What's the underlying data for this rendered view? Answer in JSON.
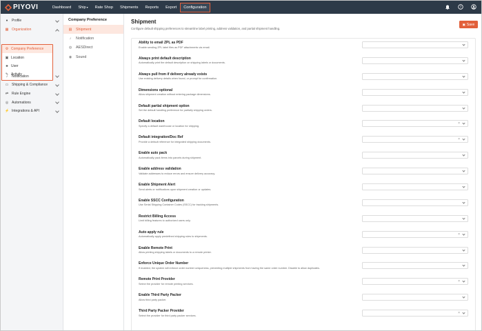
{
  "app": {
    "logo_text": "PIYOVI",
    "nav": [
      {
        "label": "Dashboard"
      },
      {
        "label": "Ship",
        "caret": "▾"
      },
      {
        "label": "Rate Shop"
      },
      {
        "label": "Shipments"
      },
      {
        "label": "Reports"
      },
      {
        "label": "Export"
      },
      {
        "label": "Configuration"
      }
    ],
    "top_icons": [
      "bell-icon",
      "help-icon",
      "user-icon"
    ],
    "accent_color": "#e2603b",
    "topbar_color": "#2d3a48"
  },
  "sidebar": {
    "items": [
      {
        "label": "Profile",
        "icon": "user-icon"
      },
      {
        "label": "Organization",
        "icon": "building-icon"
      }
    ],
    "org_sub": [
      {
        "label": "Company Preference",
        "icon": "gear-icon"
      },
      {
        "label": "Location",
        "icon": "location-icon"
      },
      {
        "label": "User",
        "icon": "users-icon"
      },
      {
        "label": "Activity",
        "icon": "activity-icon"
      }
    ],
    "items_after": [
      {
        "label": "Notification",
        "icon": "bell-icon"
      },
      {
        "label": "Shipping & Compliance",
        "icon": "truck-icon"
      },
      {
        "label": "Rule Engine",
        "icon": "rule-icon"
      },
      {
        "label": "Automations",
        "icon": "automation-icon"
      },
      {
        "label": "Integrations & API",
        "icon": "plug-icon"
      }
    ]
  },
  "sidebar2": {
    "title": "Company Preference",
    "items": [
      {
        "label": "Shipment",
        "icon": "box-icon"
      },
      {
        "label": "Notification",
        "icon": "bell-icon"
      },
      {
        "label": "AESDirect",
        "icon": "globe-icon"
      },
      {
        "label": "Sound",
        "icon": "sound-icon"
      }
    ]
  },
  "main": {
    "title": "Shipment",
    "subtitle": "Configure default shipping preferences to streamline label printing, address validation, and partial shipment handling.",
    "save_label": "Save",
    "settings": [
      {
        "label": "Ability to email ZPL as PDF",
        "desc": "Enable sending ZPL label files as PDF attachments via email.",
        "clearable": false
      },
      {
        "label": "Always print default description",
        "desc": "Automatically print the default description on shipping labels or documents.",
        "clearable": false
      },
      {
        "label": "Always pull from if delivery already exists",
        "desc": "Use existing delivery details when found, or prompt for confirmation.",
        "clearable": false
      },
      {
        "label": "Dimensions optional",
        "desc": "Allow shipment creation without entering package dimensions.",
        "clearable": false
      },
      {
        "label": "Default partial shipment option",
        "desc": "Set the default handling preference for partially shipping orders.",
        "clearable": false
      },
      {
        "label": "Default location",
        "desc": "Specify a default warehouse or location for shipping.",
        "clearable": true
      },
      {
        "label": "Default integration/Doc Ref",
        "desc": "Provide a default reference for integrated shipping documents.",
        "clearable": true
      },
      {
        "label": "Enable auto pack",
        "desc": "Automatically pack items into parcels during shipment.",
        "clearable": false
      },
      {
        "label": "Enable address validation",
        "desc": "Validate addresses to reduce errors and ensure delivery accuracy.",
        "clearable": false
      },
      {
        "label": "Enable Shipment Alert",
        "desc": "Send alerts or notifications upon shipment creation or updates.",
        "clearable": false
      },
      {
        "label": "Enable SSCC Configuration",
        "desc": "Use Serial Shipping Container Codes (SSCC) for tracking shipments.",
        "clearable": false
      },
      {
        "label": "Restrict Billing Access",
        "desc": "Limit billing features to authorized users only.",
        "clearable": false
      },
      {
        "label": "Auto apply rule",
        "desc": "Automatically apply predefined shipping rules to shipments.",
        "clearable": true
      },
      {
        "label": "Enable Remote Print",
        "desc": "Allow printing shipping labels or documents to a remote printer.",
        "clearable": false
      },
      {
        "label": "Enforce Unique Order Number",
        "desc": "If enabled, the system will enforce order number uniqueness, preventing multiple shipments from having the same order number. Disable to allow duplicates.",
        "clearable": false
      },
      {
        "label": "Remote Print Provider",
        "desc": "Select the provider for remote printing services.",
        "clearable": true
      },
      {
        "label": "Enable Third Party Packer",
        "desc": "Allow third party packer.",
        "clearable": false
      },
      {
        "label": "Third Party Packer Provider",
        "desc": "Select the provider for third party packer services.",
        "clearable": true
      }
    ]
  }
}
